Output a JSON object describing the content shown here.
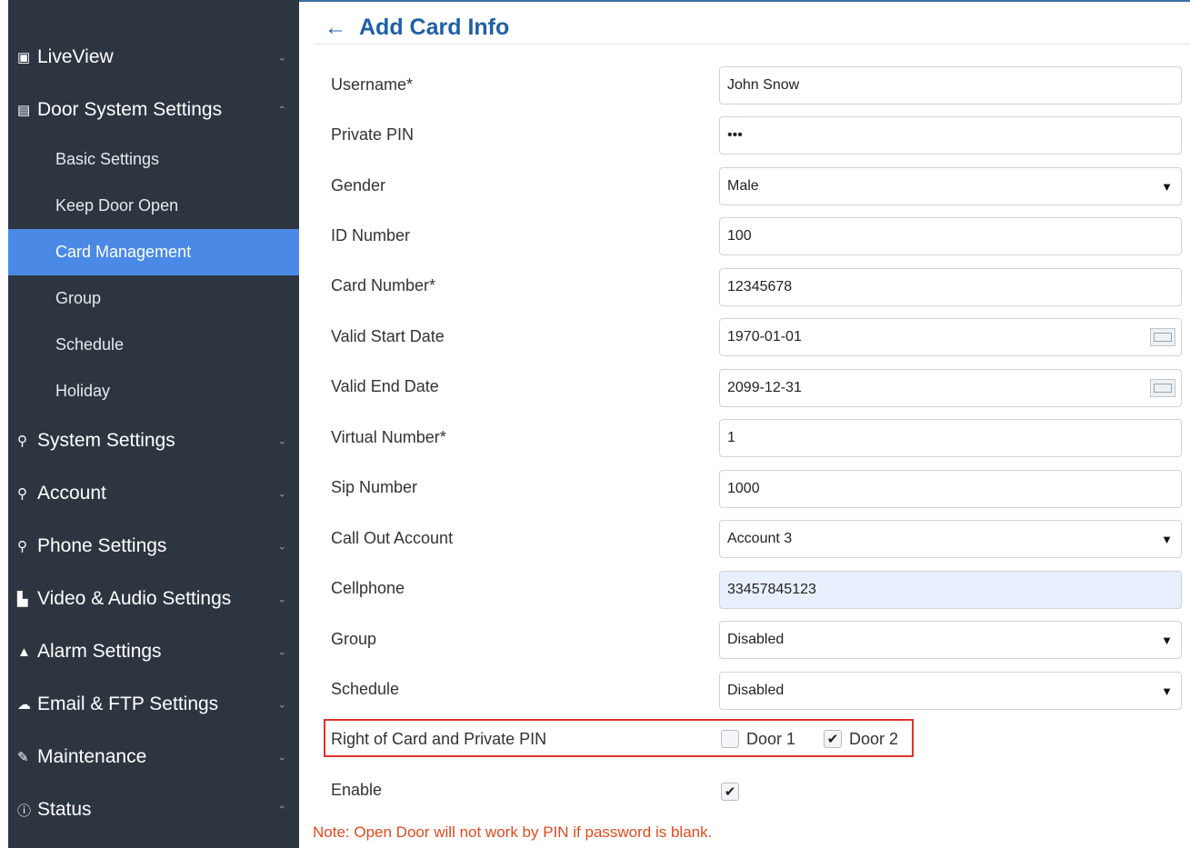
{
  "sidebar": {
    "items": [
      {
        "label": "LiveView",
        "icon": "video-icon",
        "chevron": "⌄"
      },
      {
        "label": "Door System Settings",
        "icon": "door-icon",
        "chevron": "⌃"
      },
      {
        "label": "System Settings",
        "icon": "settings-icon",
        "chevron": "⌄"
      },
      {
        "label": "Account",
        "icon": "account-icon",
        "chevron": "⌄"
      },
      {
        "label": "Phone Settings",
        "icon": "phone-icon",
        "chevron": "⌄"
      },
      {
        "label": "Video & Audio Settings",
        "icon": "media-icon",
        "chevron": "⌄"
      },
      {
        "label": "Alarm Settings",
        "icon": "bell-icon",
        "chevron": "⌄"
      },
      {
        "label": "Email & FTP Settings",
        "icon": "cloud-icon",
        "chevron": "⌄"
      },
      {
        "label": "Maintenance",
        "icon": "wrench-icon",
        "chevron": "⌄"
      },
      {
        "label": "Status",
        "icon": "info-icon",
        "chevron": "⌃"
      }
    ],
    "subitems": [
      "Basic Settings",
      "Keep Door Open",
      "Card Management",
      "Group",
      "Schedule",
      "Holiday"
    ],
    "active_subitem": "Card Management",
    "accent": "#4a8ae6",
    "background": "#2d3640"
  },
  "header": {
    "back_icon": "←",
    "title": "Add Card Info"
  },
  "form": {
    "username": {
      "label": "Username*",
      "value": "John Snow"
    },
    "private_pin": {
      "label": "Private PIN",
      "value": "•••"
    },
    "gender": {
      "label": "Gender",
      "value": "Male"
    },
    "id_number": {
      "label": "ID Number",
      "value": "100"
    },
    "card_number": {
      "label": "Card Number*",
      "value": "12345678"
    },
    "valid_start_date": {
      "label": "Valid Start Date",
      "value": "1970-01-01"
    },
    "valid_end_date": {
      "label": "Valid End Date",
      "value": "2099-12-31"
    },
    "virtual_number": {
      "label": "Virtual Number*",
      "value": "1"
    },
    "sip_number": {
      "label": "Sip Number",
      "value": "1000"
    },
    "call_out_account": {
      "label": "Call Out Account",
      "value": "Account 3"
    },
    "cellphone": {
      "label": "Cellphone",
      "value": "33457845123"
    },
    "group": {
      "label": "Group",
      "value": "Disabled"
    },
    "schedule": {
      "label": "Schedule",
      "value": "Disabled"
    },
    "right_of_card": {
      "label": "Right of Card and Private PIN",
      "door1": "Door 1",
      "door1_checked": false,
      "door2": "Door 2",
      "door2_checked": true
    },
    "enable": {
      "label": "Enable",
      "checked": true
    },
    "select_arrow": "▼",
    "check_mark": "✔"
  },
  "note": "Note: Open Door will not work by PIN if password is blank.",
  "colors": {
    "title": "#1f5fa8",
    "note": "#e04a1f",
    "highlight_border": "#e03030"
  }
}
